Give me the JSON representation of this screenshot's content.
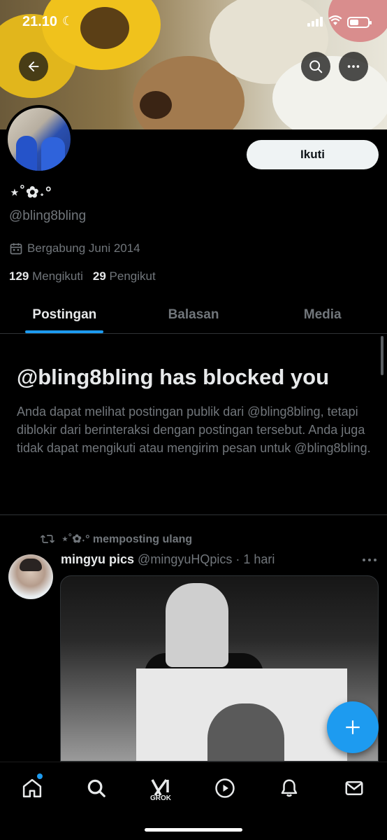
{
  "status_bar": {
    "time": "21.10"
  },
  "profile": {
    "display_name": "⋆˚✿˖°",
    "handle": "@bling8bling",
    "joined": "Bergabung Juni 2014",
    "following_count": "129",
    "following_label": "Mengikuti",
    "followers_count": "29",
    "followers_label": "Pengikut",
    "follow_button": "Ikuti"
  },
  "tabs": [
    {
      "label": "Postingan",
      "active": true
    },
    {
      "label": "Balasan",
      "active": false
    },
    {
      "label": "Media",
      "active": false
    }
  ],
  "blocked_notice": {
    "title": "@bling8bling has blocked you",
    "body": "Anda dapat melihat postingan publik dari @bling8bling, tetapi diblokir dari berinteraksi dengan postingan tersebut. Anda juga tidak dapat mengikuti atau mengirim pesan untuk @bling8bling."
  },
  "tweet": {
    "repost_label": "⋆˚✿˖° memposting ulang",
    "author_name": "mingyu pics",
    "author_handle": "@mingyuHQpics",
    "time": "· 1 hari"
  },
  "bottom_nav": {
    "grok_label": "GROK",
    "items": [
      "home-icon",
      "search-icon",
      "grok-icon",
      "video-icon",
      "notifications-icon",
      "messages-icon"
    ]
  },
  "colors": {
    "accent": "#1d9bf0",
    "background": "#000000",
    "muted_text": "#71767b"
  }
}
